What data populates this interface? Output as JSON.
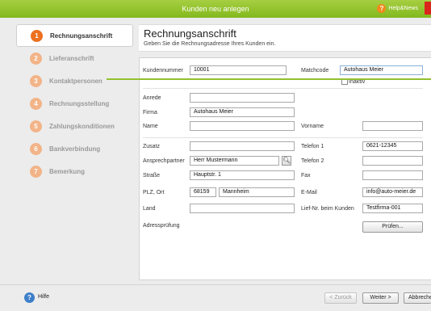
{
  "window": {
    "title": "Kunden neu anlegen",
    "help_news": "Help&News"
  },
  "steps": [
    {
      "num": "1",
      "label": "Rechnungsanschrift"
    },
    {
      "num": "2",
      "label": "Lieferanschrift"
    },
    {
      "num": "3",
      "label": "Kontaktpersonen"
    },
    {
      "num": "4",
      "label": "Rechnungsstellung"
    },
    {
      "num": "5",
      "label": "Zahlungskonditionen"
    },
    {
      "num": "6",
      "label": "Bankverbindung"
    },
    {
      "num": "7",
      "label": "Bemerkung"
    }
  ],
  "header": {
    "title": "Rechnungsanschrift",
    "subtitle": "Geben Sie die Rechnungsadresse Ihres Kunden ein."
  },
  "form": {
    "kundennummer": {
      "label": "Kundennummer",
      "value": "10001"
    },
    "matchcode": {
      "label": "Matchcode",
      "value": "Autohaus Meier"
    },
    "inaktiv": {
      "label": "Inaktiv",
      "checked": false
    },
    "anrede": {
      "label": "Anrede",
      "value": ""
    },
    "firma": {
      "label": "Firma",
      "value": "Autohaus Meier"
    },
    "name": {
      "label": "Name",
      "value": ""
    },
    "vorname": {
      "label": "Vorname",
      "value": ""
    },
    "zusatz": {
      "label": "Zusatz",
      "value": ""
    },
    "telefon1": {
      "label": "Telefon 1",
      "value": "0621-12345"
    },
    "ansprechpartner": {
      "label": "Ansprechpartner",
      "value": "Herr Mustermann"
    },
    "telefon2": {
      "label": "Telefon 2",
      "value": ""
    },
    "strasse": {
      "label": "Straße",
      "value": "Hauptstr. 1"
    },
    "fax": {
      "label": "Fax",
      "value": ""
    },
    "plz_ort": {
      "label": "PLZ,  Ort",
      "plz": "68159",
      "ort": "Mannheim"
    },
    "email": {
      "label": "E-Mail",
      "value": "info@auto-meier.de"
    },
    "land": {
      "label": "Land",
      "value": ""
    },
    "lief_nr": {
      "label": "Lief-Nr. beim Kunden",
      "value": "Testfirma-001"
    },
    "adresspruefung": {
      "label": "Adressprüfung",
      "button": "Prüfen..."
    }
  },
  "footer": {
    "help": "Hilfe",
    "back": "< Zurück",
    "next": "Weiter >",
    "cancel": "Abbrechen"
  },
  "colors": {
    "accent_green": "#93c02e",
    "step_active": "#ec7020",
    "step_inactive": "#f2b488"
  }
}
